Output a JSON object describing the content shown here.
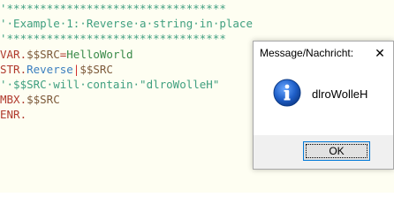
{
  "editor": {
    "lines": [
      {
        "parts": [
          {
            "text": "'*********************************",
            "cls": "t-comment"
          }
        ]
      },
      {
        "parts": [
          {
            "text": "'·Example·1:·Reverse·a·string·in·place",
            "cls": "t-comment"
          }
        ]
      },
      {
        "parts": [
          {
            "text": "'*********************************",
            "cls": "t-comment"
          }
        ]
      },
      {
        "parts": [
          {
            "text": "VAR.",
            "cls": "t-kw"
          },
          {
            "text": "$$SRC",
            "cls": "t-var"
          },
          {
            "text": "=",
            "cls": "t-kw"
          },
          {
            "text": "HelloWorld",
            "cls": "t-str"
          }
        ]
      },
      {
        "parts": [
          {
            "text": "STR.",
            "cls": "t-kw"
          },
          {
            "text": "Reverse",
            "cls": "t-method"
          },
          {
            "text": "|",
            "cls": "t-op"
          },
          {
            "text": "$$SRC",
            "cls": "t-var"
          }
        ]
      },
      {
        "parts": [
          {
            "text": "'·$$SRC·will·contain·\"dlroWolleH\"",
            "cls": "t-comment"
          }
        ]
      },
      {
        "parts": [
          {
            "text": "MBX.",
            "cls": "t-kw"
          },
          {
            "text": "$$SRC",
            "cls": "t-var"
          }
        ]
      },
      {
        "parts": [
          {
            "text": "ENR.",
            "cls": "t-kw"
          }
        ]
      }
    ]
  },
  "dialog": {
    "title": "Message/Nachricht:",
    "message": "dlroWolleH",
    "ok_label": "OK",
    "close_glyph": "✕",
    "icon": "information-icon",
    "accent": "#1a5fb4"
  }
}
